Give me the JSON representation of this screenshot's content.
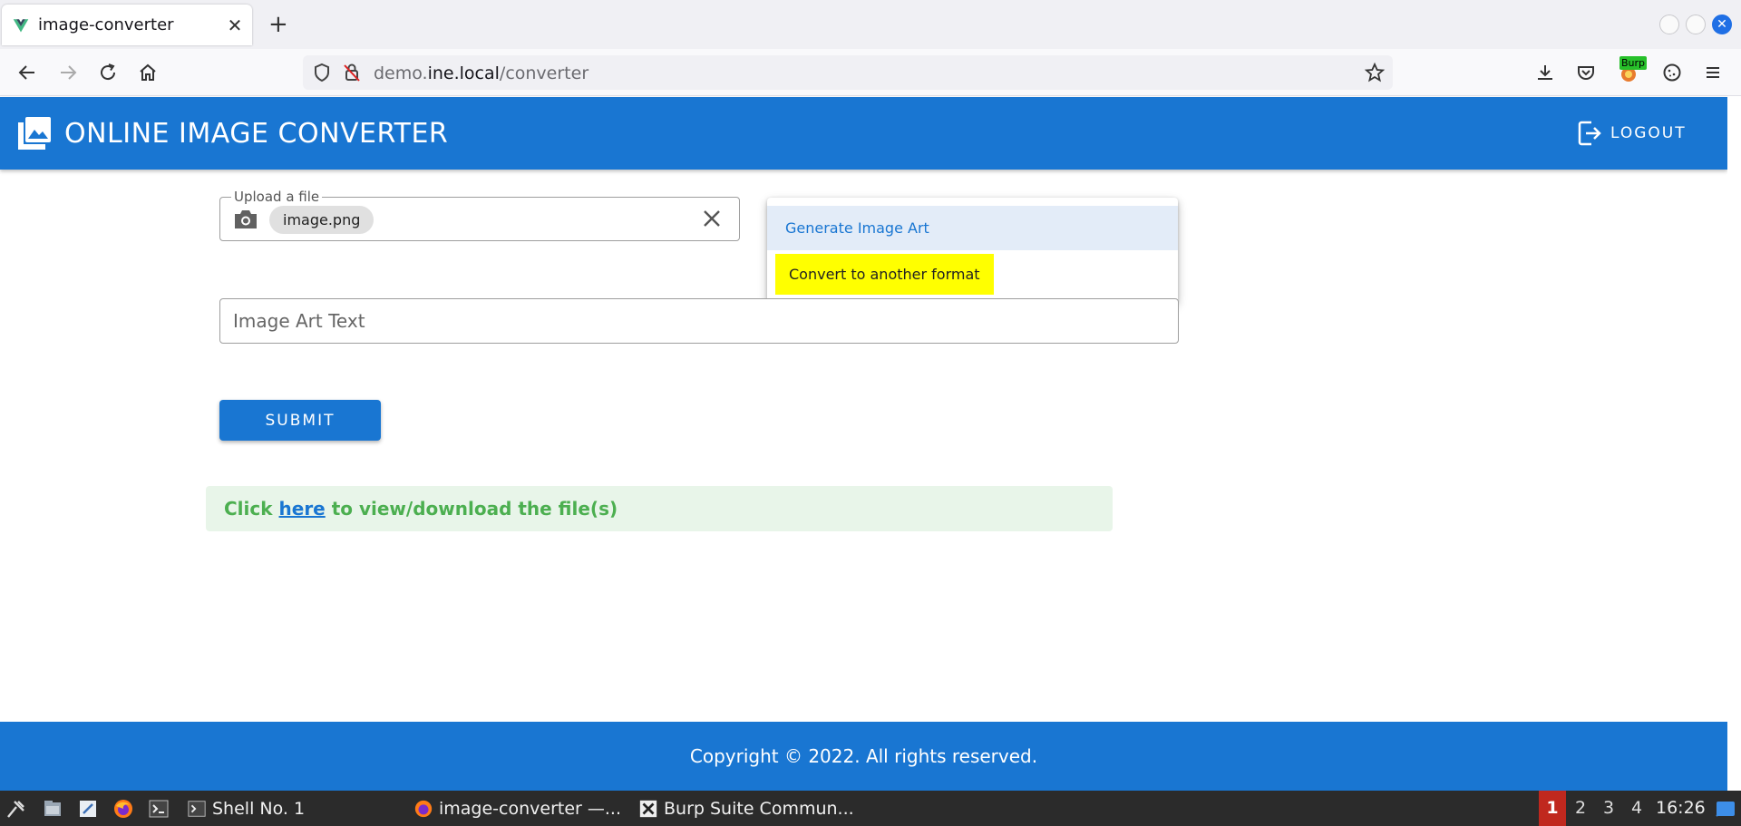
{
  "browser": {
    "tab_title": "image-converter",
    "url_prefix": "demo.",
    "url_host": "ine.local",
    "url_path": "/converter",
    "burp_label": "Burp"
  },
  "app": {
    "title": "ONLINE IMAGE CONVERTER",
    "logout_label": "LOGOUT",
    "upload": {
      "legend": "Upload a file",
      "file_chip": "image.png"
    },
    "menu": {
      "items": [
        "Generate Image Art",
        "Convert to another format"
      ]
    },
    "art_text_placeholder": "Image Art Text",
    "submit_label": "SUBMIT",
    "alert": {
      "pre": "Click ",
      "link": "here",
      "post": " to view/download the file(s)"
    },
    "footer": "Copyright © 2022. All rights reserved."
  },
  "taskbar": {
    "tasks": [
      "Shell No. 1",
      "image-converter —...",
      "Burp Suite Commun..."
    ],
    "workspaces": [
      "1",
      "2",
      "3",
      "4"
    ],
    "clock": "16:26"
  },
  "colors": {
    "primary": "#1976d2",
    "highlight": "#ffff00",
    "success_text": "#4caf50",
    "success_bg": "#e8f5e9",
    "taskbar": "#2b2b2b",
    "workspace_active": "#c0281e"
  }
}
